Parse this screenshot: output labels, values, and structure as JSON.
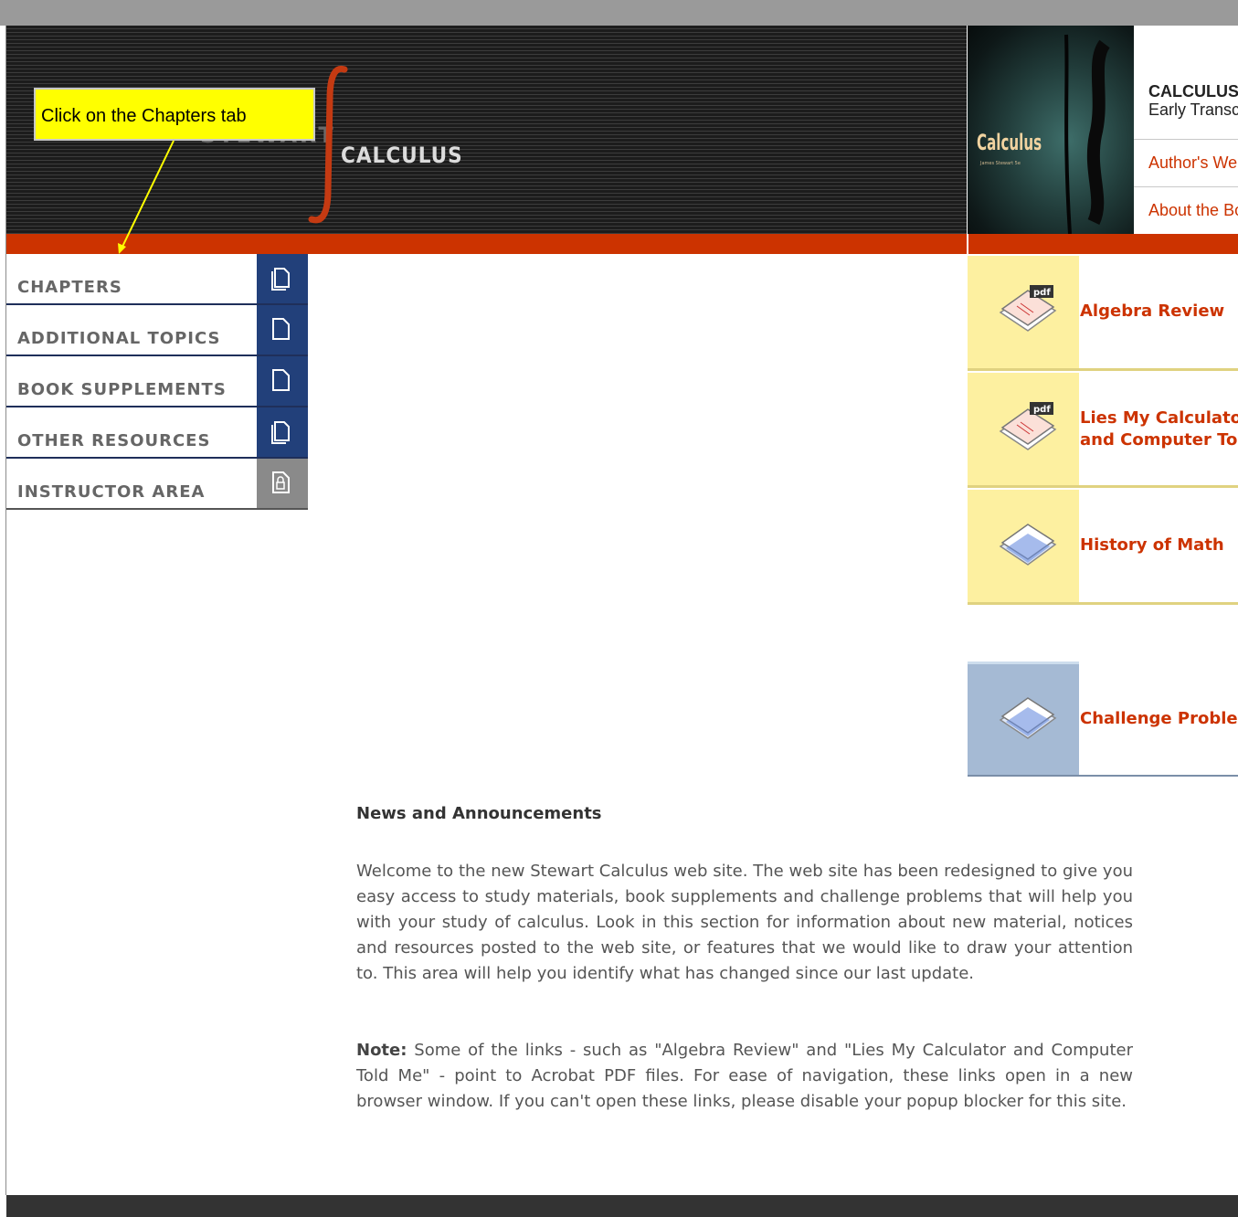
{
  "banner": {
    "logo_text": "STEWART",
    "calculus_word": "CALCULUS"
  },
  "cover": {
    "title": "Calculus",
    "subtitle": "James Stewart 5e"
  },
  "book_info": {
    "title": "CALCULUS",
    "edition": "Early Transcendentals",
    "links": [
      "Author's Website",
      "About the Book"
    ]
  },
  "callout": {
    "text": "Click on the Chapters tab"
  },
  "nav": {
    "items": [
      {
        "label": "CHAPTERS",
        "icon": "pages-icon"
      },
      {
        "label": "ADDITIONAL TOPICS",
        "icon": "page-icon"
      },
      {
        "label": "BOOK SUPPLEMENTS",
        "icon": "page-icon"
      },
      {
        "label": "OTHER RESOURCES",
        "icon": "pages-icon"
      },
      {
        "label": "INSTRUCTOR AREA",
        "icon": "lock-page-icon"
      }
    ]
  },
  "resources": {
    "items": [
      {
        "line1": "Algebra Review",
        "line2": "",
        "icon": "pdf-document-icon"
      },
      {
        "line1": "Lies My Calculator",
        "line2": "and Computer Told Me",
        "icon": "pdf-document-icon"
      },
      {
        "line1": "History of Math",
        "line2": "",
        "icon": "document-icon"
      },
      {
        "line1": "Challenge Problems",
        "line2": "",
        "icon": "document-icon"
      }
    ]
  },
  "news": {
    "heading": "News and Announcements",
    "paragraph1": "Welcome to the new Stewart Calculus web site. The web site has been redesigned to give you easy access to study materials, book supplements and challenge problems that will help you with your study of calculus. Look in this section for information about new material, notices and resources posted to the web site, or features that we would like to draw your attention to. This area will help you identify what has changed since our last update.",
    "note_label": "Note:",
    "paragraph2": " Some of the links - such as \"Algebra Review\" and \"Lies My Calculator and Computer Told Me\" - point to Acrobat PDF files. For ease of navigation, these links open in a new browser window. If you can't open these links, please disable your popup blocker for this site."
  },
  "colors": {
    "accent": "#cc3300",
    "nav_icon_bg": "#22407a",
    "callout_bg": "#ffff00",
    "resource_bg": "#fdf0a0",
    "resource_blue_bg": "#a5bad4"
  }
}
